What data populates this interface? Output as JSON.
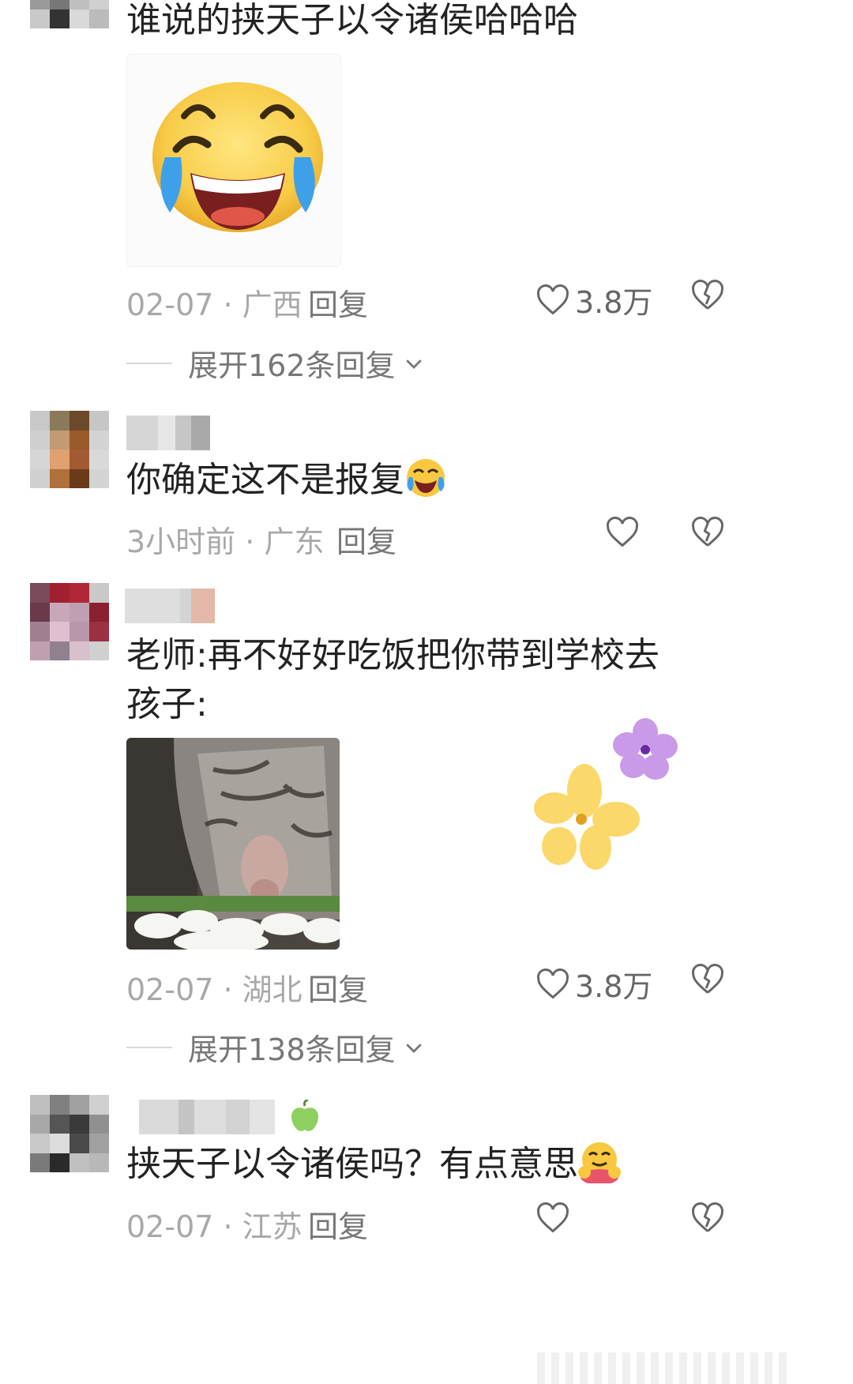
{
  "comments": [
    {
      "text": "谁说的挟天子以令诸侯哈哈哈",
      "image": "laughing-crying-emoji-sticker",
      "date": "02-07",
      "location": "广西",
      "reply": "回复",
      "likes": "3.8万",
      "expand": "展开162条回复"
    },
    {
      "text": "你确定这不是报复",
      "emoji": "laughing-crying-emoji",
      "date": "3小时前",
      "location": "广东",
      "reply": "回复"
    },
    {
      "text_line1": "老师:再不好好吃饭把你带到学校去",
      "text_line2": "孩子:",
      "image": "cat-eating-rice-photo",
      "date": "02-07",
      "location": "湖北",
      "reply": "回复",
      "likes": "3.8万",
      "expand": "展开138条回复"
    },
    {
      "text": "挟天子以令诸侯吗？有点意思",
      "emoji": "hugging-face-emoji",
      "badge": "green-apple-icon",
      "date": "02-07",
      "location": "江苏",
      "reply": "回复"
    }
  ],
  "separator": " · ",
  "colors": {
    "text": "#222222",
    "meta": "#a8a8a8",
    "icon": "#666666",
    "flower_purple": "#c99ae8",
    "flower_yellow": "#fbd86a"
  }
}
